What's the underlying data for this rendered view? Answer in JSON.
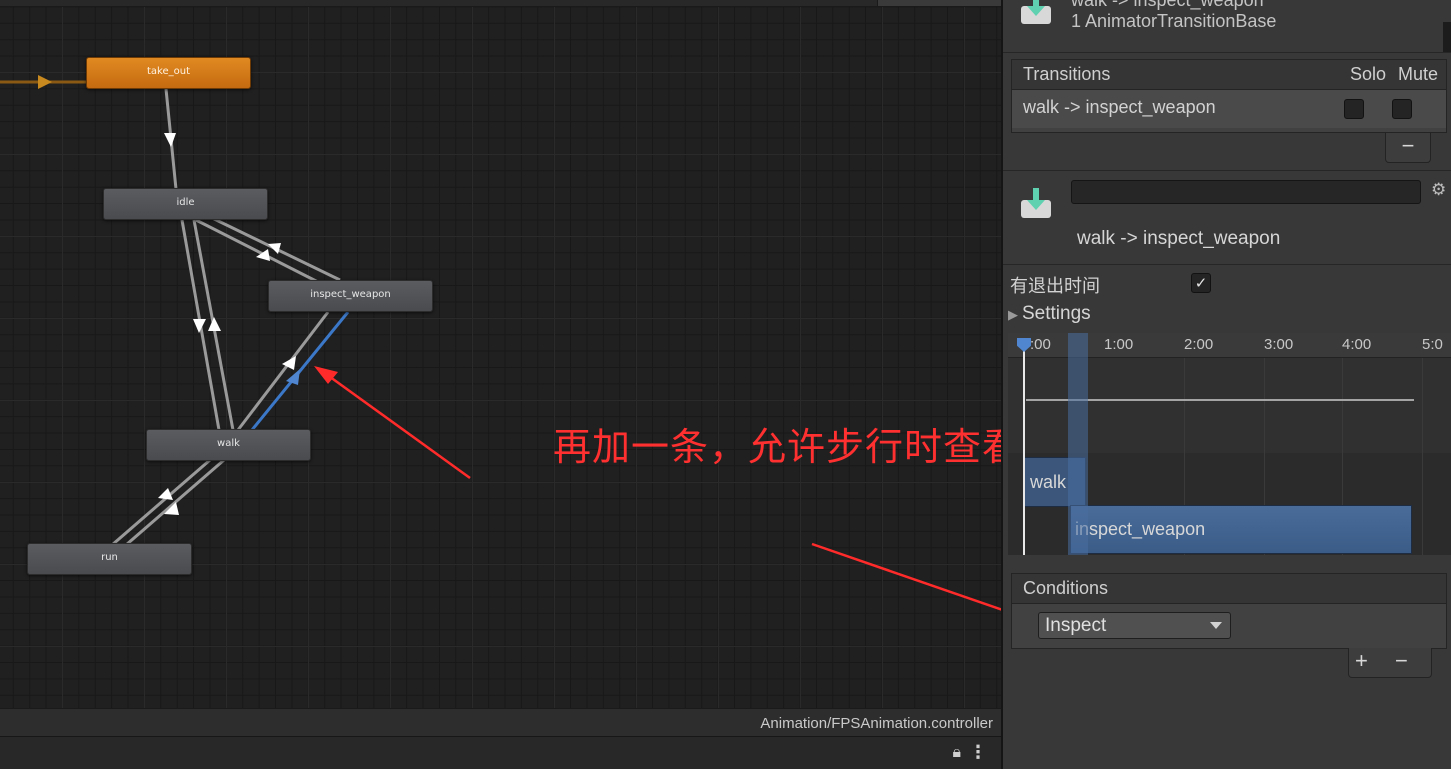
{
  "graph": {
    "states": [
      {
        "id": "take_out",
        "label": "take_out",
        "default": true
      },
      {
        "id": "idle",
        "label": "idle"
      },
      {
        "id": "inspect_weapon",
        "label": "inspect_weapon"
      },
      {
        "id": "walk",
        "label": "walk"
      },
      {
        "id": "run",
        "label": "run"
      }
    ],
    "annotation": "再加一条，允许步行时查看武器",
    "annotation_color": "#ff3030"
  },
  "path_bar": {
    "text": "Animation/FPSAnimation.controller"
  },
  "status_bar": {
    "lock_icon": "lock-icon",
    "menu_icon": "kebab-menu-icon"
  },
  "inspector": {
    "header_line1": "walk -> inspect_weapon",
    "header_line2": "1 AnimatorTransitionBase",
    "transitions": {
      "title": "Transitions",
      "solo_label": "Solo",
      "mute_label": "Mute",
      "rows": [
        {
          "label": "walk -> inspect_weapon"
        }
      ],
      "remove_label": "−"
    },
    "transition_title": "walk -> inspect_weapon",
    "name_value": "",
    "has_exit_time_label": "有退出时间",
    "has_exit_time_checked": "✓",
    "settings_label": "Settings",
    "timeline": {
      "ticks": [
        ":00",
        "1:00",
        "2:00",
        "3:00",
        "4:00",
        "5:0"
      ],
      "clip_from": "walk",
      "clip_to": "inspect_weapon"
    },
    "conditions": {
      "title": "Conditions",
      "items": [
        {
          "value": "Inspect"
        }
      ],
      "add_label": "+",
      "remove_label": "−"
    }
  },
  "colors": {
    "accent_blue": "#4f86cf",
    "default_state": "#e08a22",
    "annotation": "#ff3030"
  }
}
